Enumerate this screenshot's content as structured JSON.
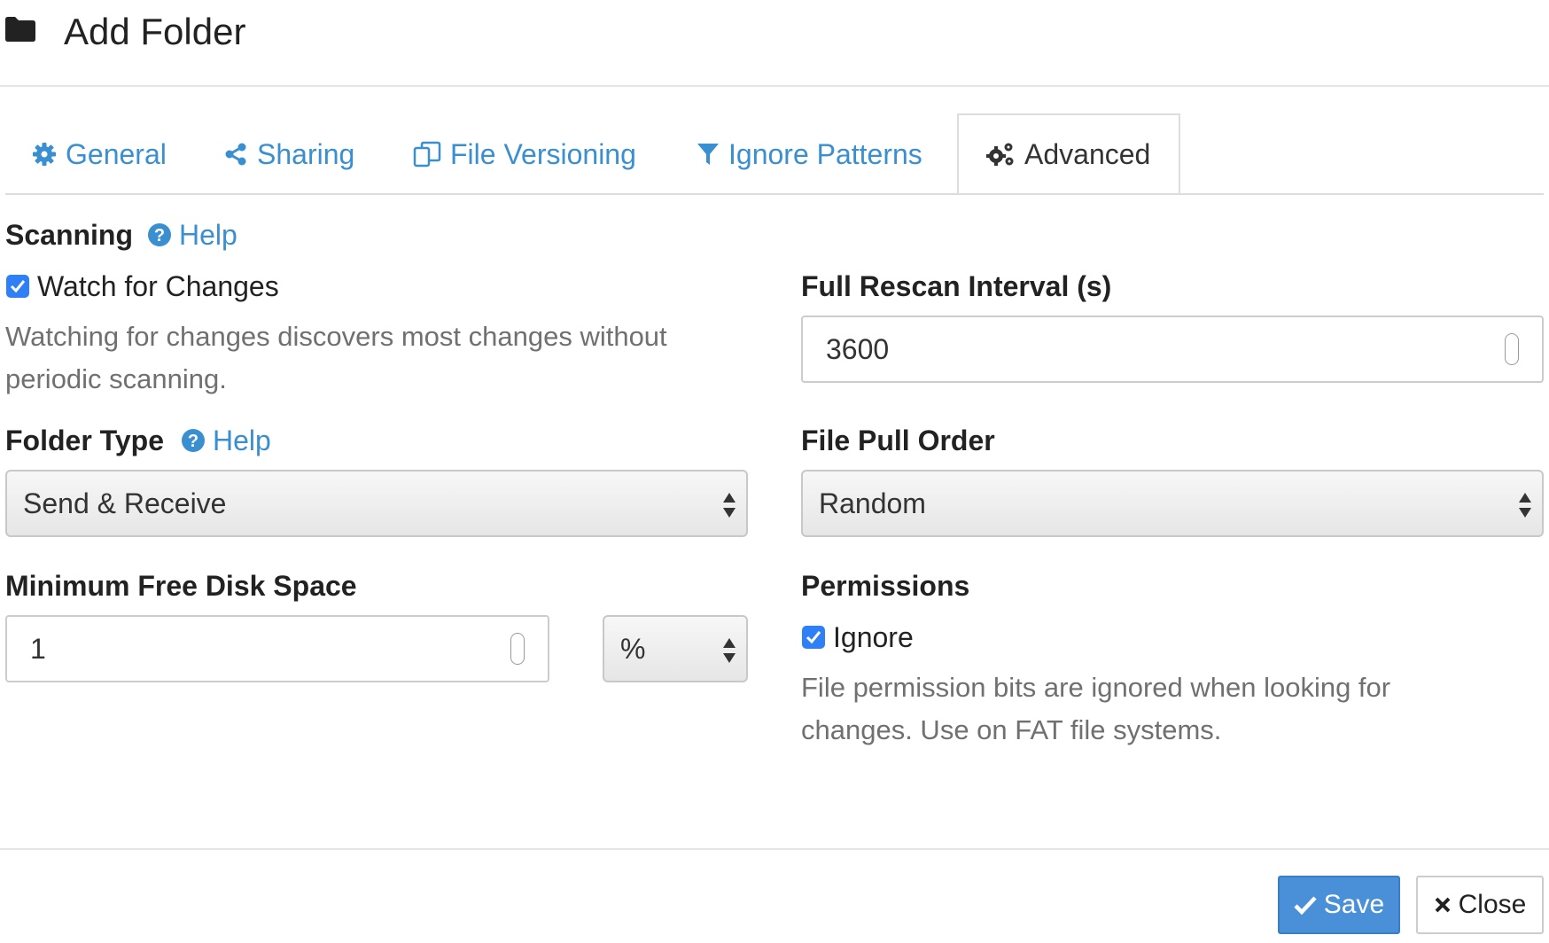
{
  "header": {
    "title": "Add Folder",
    "icon": "folder-icon"
  },
  "tabs": [
    {
      "label": "General",
      "icon": "gear-icon",
      "active": false
    },
    {
      "label": "Sharing",
      "icon": "share-icon",
      "active": false
    },
    {
      "label": "File Versioning",
      "icon": "copy-icon",
      "active": false
    },
    {
      "label": "Ignore Patterns",
      "icon": "filter-icon",
      "active": false
    },
    {
      "label": "Advanced",
      "icon": "gears-icon",
      "active": true
    }
  ],
  "scanning": {
    "label": "Scanning",
    "help_label": "Help",
    "watch_label": "Watch for Changes",
    "watch_checked": true,
    "watch_description": "Watching for changes discovers most changes without periodic scanning."
  },
  "rescan": {
    "label": "Full Rescan Interval (s)",
    "value": "3600"
  },
  "folder_type": {
    "label": "Folder Type",
    "help_label": "Help",
    "value": "Send & Receive"
  },
  "pull_order": {
    "label": "File Pull Order",
    "value": "Random"
  },
  "disk_space": {
    "label": "Minimum Free Disk Space",
    "value": "1",
    "unit": "%"
  },
  "permissions": {
    "label": "Permissions",
    "ignore_label": "Ignore",
    "ignore_checked": true,
    "description": "File permission bits are ignored when looking for changes. Use on FAT file systems."
  },
  "footer": {
    "save_label": "Save",
    "close_label": "Close"
  },
  "colors": {
    "link": "#3a8fd0",
    "primary": "#4a90d9",
    "checkbox": "#2f7ff7"
  }
}
